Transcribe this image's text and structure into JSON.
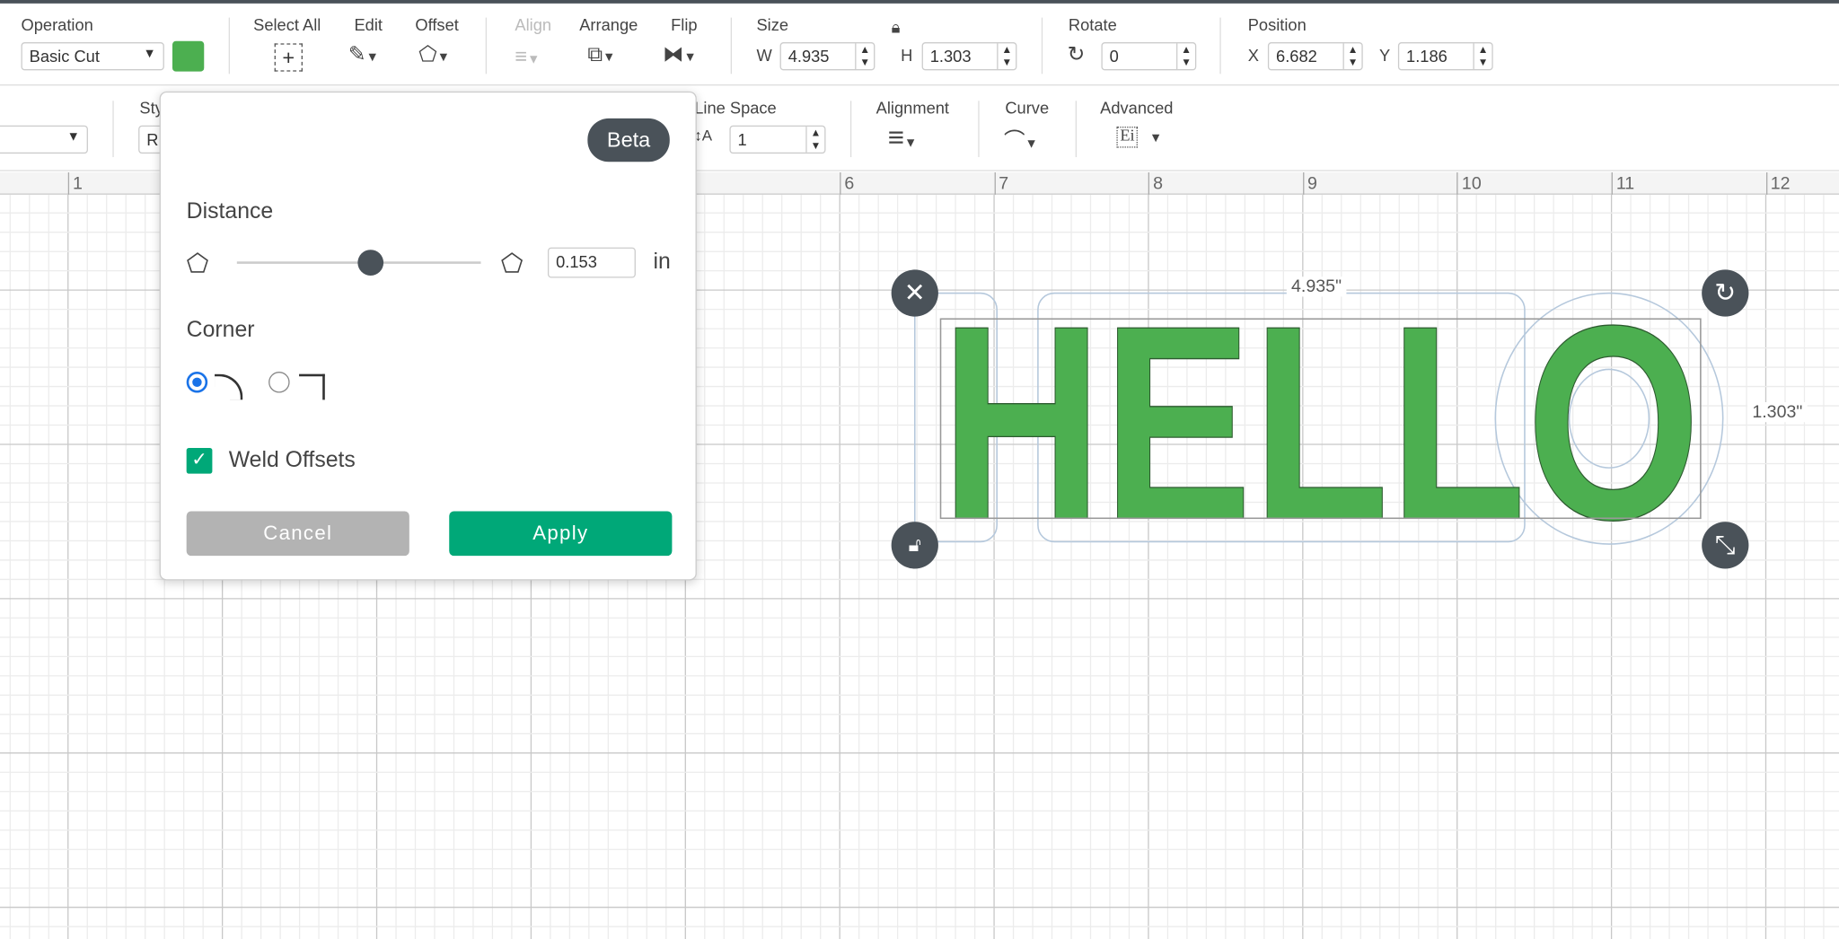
{
  "toolbar": {
    "operation_label": "Operation",
    "operation_value": "Basic Cut",
    "color": "#4caf50",
    "select_all": "Select All",
    "edit": "Edit",
    "offset": "Offset",
    "align": "Align",
    "arrange": "Arrange",
    "flip": "Flip",
    "size": "Size",
    "w_label": "W",
    "w_value": "4.935",
    "h_label": "H",
    "h_value": "1.303",
    "rotate": "Rotate",
    "rotate_value": "0",
    "position": "Position",
    "x_label": "X",
    "x_value": "6.682",
    "y_label": "Y",
    "y_value": "1.186"
  },
  "text_toolbar": {
    "style_label": "Sty",
    "style_value": "R",
    "line_space": "Line Space",
    "line_space_value": "1",
    "alignment": "Alignment",
    "curve": "Curve",
    "advanced": "Advanced",
    "advanced_icon_text": "Ei"
  },
  "ruler": [
    "1",
    "6",
    "7",
    "8",
    "9",
    "10",
    "11",
    "12"
  ],
  "offset_panel": {
    "badge": "Beta",
    "distance_label": "Distance",
    "distance_value": "0.153",
    "unit": "in",
    "distance_fraction": 0.55,
    "corner_label": "Corner",
    "corner_selected": "rounded",
    "weld_label": "Weld Offsets",
    "weld_checked": true,
    "cancel": "Cancel",
    "apply": "Apply",
    "apply_color": "#00a878"
  },
  "canvas": {
    "text": "HELLO",
    "width_dim": "4.935\"",
    "height_dim": "1.303\"",
    "fill": "#4caf50"
  }
}
